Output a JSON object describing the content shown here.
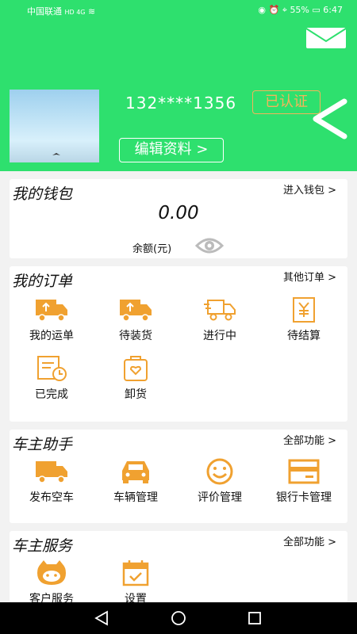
{
  "status_bar": {
    "carrier": "中国联通",
    "network": "HD 4G",
    "battery": "55%",
    "time": "6:47"
  },
  "header": {
    "phone": "132****1356",
    "verified_badge": "已认证",
    "edit_profile": "编辑资料 >"
  },
  "wallet": {
    "title": "我的钱包",
    "more": "进入钱包 >",
    "amount": "0.00",
    "balance_label": "余额(元)"
  },
  "orders": {
    "title": "我的订单",
    "more": "其他订单 >",
    "items": [
      {
        "label": "我的运单",
        "icon": "truck-upload-icon"
      },
      {
        "label": "待装货",
        "icon": "truck-load-icon"
      },
      {
        "label": "进行中",
        "icon": "truck-moving-icon"
      },
      {
        "label": "待结算",
        "icon": "bill-icon"
      },
      {
        "label": "已完成",
        "icon": "completed-clock-icon"
      },
      {
        "label": "卸货",
        "icon": "unload-bag-icon"
      }
    ]
  },
  "assistant": {
    "title": "车主助手",
    "more": "全部功能 >",
    "items": [
      {
        "label": "发布空车",
        "icon": "truck-icon"
      },
      {
        "label": "车辆管理",
        "icon": "car-icon"
      },
      {
        "label": "评价管理",
        "icon": "smiley-icon"
      },
      {
        "label": "银行卡管理",
        "icon": "bank-card-icon"
      }
    ]
  },
  "services": {
    "title": "车主服务",
    "more": "全部功能 >",
    "items": [
      {
        "label": "客户服务",
        "icon": "customer-service-icon"
      },
      {
        "label": "设置",
        "icon": "settings-calendar-icon"
      }
    ]
  },
  "colors": {
    "brand_green": "#2ee06e",
    "accent_orange": "#f0a130",
    "badge_orange": "#f3b45a"
  }
}
